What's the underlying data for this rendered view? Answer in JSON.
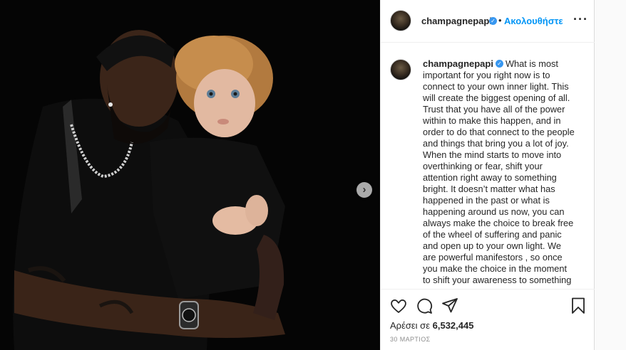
{
  "post": {
    "photo": {
      "alt": ""
    },
    "next_icon": "chevron-right-icon",
    "next_glyph": "›"
  },
  "header": {
    "username": "champagnepapi",
    "verified_glyph": "✓",
    "separator": "•",
    "follow_label": "Ακολουθήστε",
    "more_glyph": "···"
  },
  "caption": {
    "username": "champagnepapi",
    "verified_glyph": "✓",
    "text": "What is most important for you right now is to connect to your own inner light. This will create the biggest opening of all. Trust that you have all of the power within to make this happen, and in order to do that connect to the people and things that bring you a lot of joy. When the mind starts to move into overthinking or fear, shift your attention right away to something bright. It doesn’t matter what has happened in the past or what is happening around us now, you can always make the choice to break free of the wheel of suffering and panic and open up to your own light. We are powerful manifestors , so once you make the choice in the moment to shift your awareness to something"
  },
  "actions": {
    "icons": [
      "heart-icon",
      "comment-icon",
      "share-icon",
      "bookmark-icon"
    ],
    "likes_prefix": "Αρέσει σε",
    "likes_count": "6,532,445",
    "date": "30 ΜΑΡΤΙΟΣ"
  },
  "colors": {
    "accent": "#0095f6",
    "verified": "#3897f0",
    "text": "#262626",
    "muted": "#8e8e8e",
    "image_bg": "#050505"
  }
}
